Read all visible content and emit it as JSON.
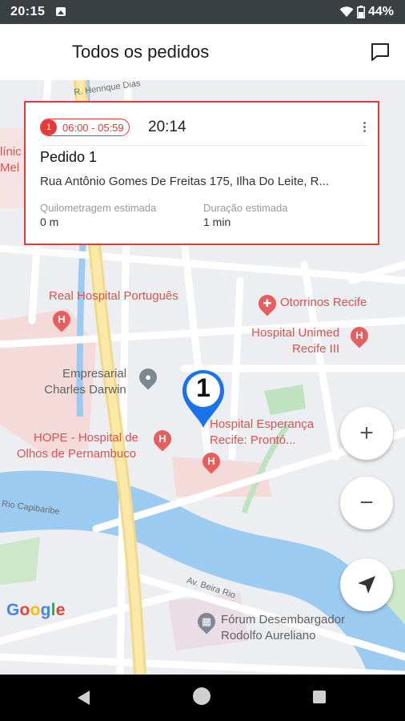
{
  "status_bar": {
    "time": "20:15",
    "battery": "44%"
  },
  "app_bar": {
    "title": "Todos os pedidos"
  },
  "order_card": {
    "badge_number": "1",
    "time_window": "06:00 - 05:59",
    "time": "20:14",
    "title": "Pedido 1",
    "address": "Rua Antônio Gomes De Freitas 175, Ilha Do Leite, R...",
    "distance_label": "Quilometragem estimada",
    "distance_value": "0 m",
    "duration_label": "Duração estimada",
    "duration_value": "1 min"
  },
  "map": {
    "places": {
      "real_hospital": "Real Hospital Português",
      "otorrinos": "Otorrinos Recife",
      "unimed_line1": "Hospital Unimed",
      "unimed_line2": "Recife III",
      "empresarial_line1": "Empresarial",
      "empresarial_line2": "Charles Darwin",
      "hope_line1": "HOPE - Hospital de",
      "hope_line2": "Olhos de Pernambuco",
      "esperanca_line1": "Hospital Esperança",
      "esperanca_line2": "Recife: Prontó...",
      "forum_line1": "Fórum Desembargador",
      "forum_line2": "Rodolfo Aureliano",
      "clinica_line1": "línic",
      "clinica_line2": "Mel"
    },
    "streets": {
      "henrique_dias": "R. Henrique Dias",
      "rio_capibaribe": "Rio Capibaribe",
      "av_beira_rio": "Av. Beira Rio"
    },
    "pin_label": "1",
    "attribution": "Google",
    "zoom_in": "+",
    "zoom_out": "−"
  },
  "icons": {
    "chat": "chat-icon",
    "wifi": "wifi-icon",
    "battery": "battery-icon",
    "image": "image-icon",
    "location": "navigation-icon",
    "overflow": "more-vert-icon"
  },
  "colors": {
    "accent": "#e53935",
    "pin": "#1a73e8",
    "status_bar": "#3a3f44",
    "water": "#9ccbf2",
    "highway": "#f8e08a"
  }
}
